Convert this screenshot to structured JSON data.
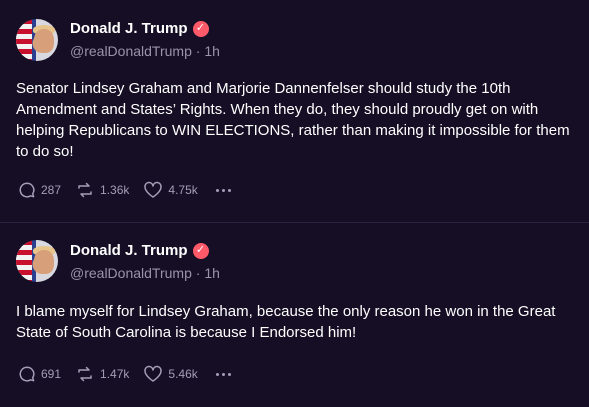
{
  "posts": [
    {
      "author": "Donald J. Trump",
      "handle": "@realDonaldTrump",
      "separator": "·",
      "time": "1h",
      "text": "Senator Lindsey Graham and Marjorie Dannenfelser should study the 10th Amendment and States’ Rights. When they do, they should proudly get on with helping Republicans to WIN ELECTIONS, rather than making it impossible for them to do so!",
      "replies": "287",
      "retruths": "1.36k",
      "likes": "4.75k"
    },
    {
      "author": "Donald J. Trump",
      "handle": "@realDonaldTrump",
      "separator": "·",
      "time": "1h",
      "text": "I blame myself for Lindsey Graham, because the only reason he won in the Great State of South Carolina is because I Endorsed him!",
      "replies": "691",
      "retruths": "1.47k",
      "likes": "5.46k"
    }
  ],
  "colors": {
    "background": "#150e24",
    "verified_badge": "#ff5a6a",
    "muted_text": "#9a93aa"
  },
  "icons": [
    "reply-icon",
    "retruth-icon",
    "like-icon",
    "more-icon",
    "verified-icon"
  ]
}
